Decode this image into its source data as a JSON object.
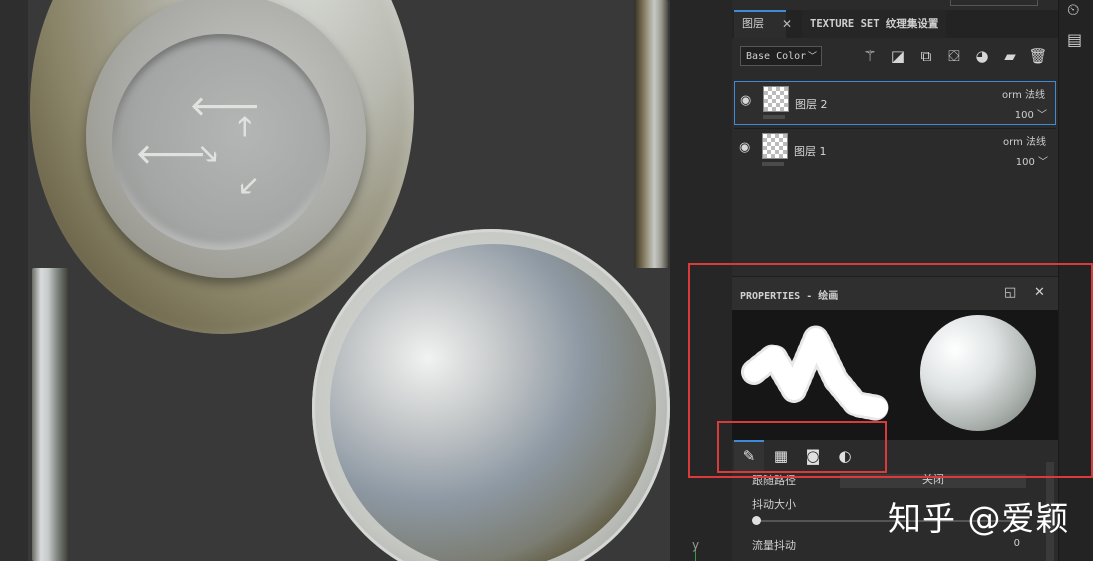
{
  "viewport": {
    "axis_label": "y"
  },
  "tabs": [
    {
      "label": "图层",
      "close": "✕"
    },
    {
      "label": "TEXTURE SET 纹理集设置"
    }
  ],
  "toolbar": {
    "channel": "Base Color",
    "icons": [
      "magic-wand-icon",
      "mask-icon",
      "add-layer-icon",
      "fill-layer-icon",
      "effect-icon",
      "folder-icon",
      "delete-icon"
    ]
  },
  "layers": [
    {
      "name": "图层 2",
      "blend": "orm 法线",
      "opacity": "100",
      "selected": true
    },
    {
      "name": "图层 1",
      "blend": "orm 法线",
      "opacity": "100",
      "selected": false
    }
  ],
  "properties": {
    "title": "PROPERTIES - 绘画",
    "tabs": [
      "brush-icon",
      "material-icon",
      "mask-icon",
      "particle-icon"
    ]
  },
  "params": {
    "follow_path": {
      "label": "跟随路径",
      "value": "关闭"
    },
    "jitter_size": {
      "label": "抖动大小"
    },
    "flow_jitter": {
      "label": "流量抖动",
      "value": "0"
    }
  },
  "watermark": "知乎 @爱颖",
  "colors": {
    "accent": "#3f8bd8",
    "highlight": "#d93a3a"
  }
}
